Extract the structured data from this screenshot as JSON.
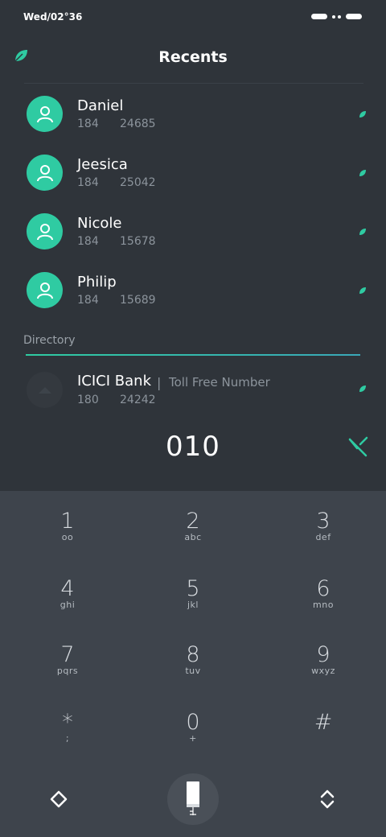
{
  "status_bar": {
    "time": "Wed/02°36"
  },
  "header": {
    "title": "Recents"
  },
  "colors": {
    "accent": "#2fcba2",
    "background": "#2f343a",
    "keypad": "#3e444c",
    "muted": "#8c949c"
  },
  "recents": [
    {
      "name": "Daniel",
      "prefix": "184",
      "number": "24685"
    },
    {
      "name": "Jeesica",
      "prefix": "184",
      "number": "25042"
    },
    {
      "name": "Nicole",
      "prefix": "184",
      "number": "15678"
    },
    {
      "name": "Philip",
      "prefix": "184",
      "number": "15689"
    }
  ],
  "directory": {
    "label": "Directory",
    "item": {
      "name": "ICICI Bank",
      "separator": "|",
      "tag": "Toll Free Number",
      "prefix": "180",
      "number": "24242"
    }
  },
  "dialer": {
    "input": "010"
  },
  "keypad": [
    {
      "digit": "1",
      "letters": "oo"
    },
    {
      "digit": "2",
      "letters": "abc"
    },
    {
      "digit": "3",
      "letters": "def"
    },
    {
      "digit": "4",
      "letters": "ghi"
    },
    {
      "digit": "5",
      "letters": "jkl"
    },
    {
      "digit": "6",
      "letters": "mno"
    },
    {
      "digit": "7",
      "letters": "pqrs"
    },
    {
      "digit": "8",
      "letters": "tuv"
    },
    {
      "digit": "9",
      "letters": "wxyz"
    },
    {
      "digit": "*",
      "letters": ";"
    },
    {
      "digit": "0",
      "letters": "+"
    },
    {
      "digit": "#",
      "letters": ""
    }
  ],
  "icons": {
    "logo": "leaf-icon",
    "clear": "clear-backspace-icon",
    "call": "phone-handset-icon",
    "left_nav": "diamond-icon",
    "right_nav": "chevron-up-down-icon"
  }
}
